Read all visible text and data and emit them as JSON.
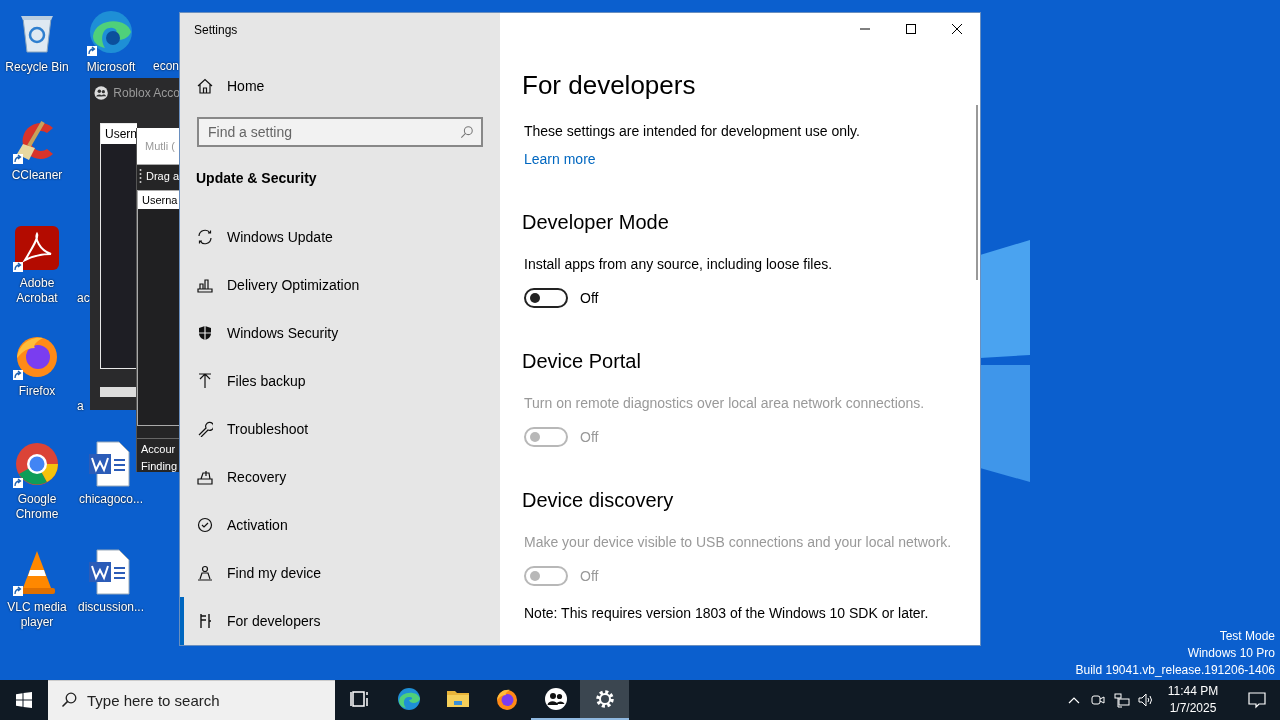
{
  "desktop": {
    "icon_columns": [
      [
        {
          "label": "Recycle Bin",
          "kind": "recycle"
        },
        {
          "label": "CCleaner",
          "kind": "ccleaner"
        },
        {
          "label": "Adobe Acrobat",
          "kind": "acrobat"
        },
        {
          "label": "Firefox",
          "kind": "firefox"
        },
        {
          "label": "Google Chrome",
          "kind": "chrome"
        },
        {
          "label": "VLC media player",
          "kind": "vlc"
        }
      ],
      [
        {
          "label": "Microsoft",
          "kind": "edge"
        },
        {
          "kind": "hidden"
        },
        {
          "label": "ac",
          "kind": "cut"
        },
        {
          "label": "a",
          "kind": "cut"
        },
        {
          "label": "chicagoco...",
          "kind": "word"
        },
        {
          "label": "discussion...",
          "kind": "word"
        }
      ],
      [
        {
          "label": "econ",
          "kind": "cut"
        }
      ]
    ],
    "system_text": [
      "Test Mode",
      "Windows 10 Pro",
      "Build 19041.vb_release.191206-1406"
    ]
  },
  "roblox_window": {
    "title": "Roblox Acco",
    "list_header": "Usern"
  },
  "multi_window": {
    "field": "Mutli (",
    "drag_label": "Drag a",
    "list_header": "Userna",
    "status_lines": [
      "Accour",
      "Finding"
    ]
  },
  "settings": {
    "title": "Settings",
    "home": "Home",
    "search": {
      "placeholder": "Find a setting"
    },
    "section": "Update & Security",
    "nav": [
      {
        "label": "Windows Update",
        "kind": "sync",
        "selected": false
      },
      {
        "label": "Delivery Optimization",
        "kind": "delivery",
        "selected": false
      },
      {
        "label": "Windows Security",
        "kind": "shield",
        "selected": false
      },
      {
        "label": "Files backup",
        "kind": "backup",
        "selected": false
      },
      {
        "label": "Troubleshoot",
        "kind": "wrench",
        "selected": false
      },
      {
        "label": "Recovery",
        "kind": "recovery",
        "selected": false
      },
      {
        "label": "Activation",
        "kind": "check",
        "selected": false
      },
      {
        "label": "Find my device",
        "kind": "find",
        "selected": false
      },
      {
        "label": "For developers",
        "kind": "developer",
        "selected": true
      }
    ],
    "page": {
      "title": "For developers",
      "intro": "These settings are intended for development use only.",
      "link": "Learn more",
      "sections": [
        {
          "heading": "Developer Mode",
          "description": "Install apps from any source, including loose files.",
          "toggle": {
            "on": false,
            "disabled": false,
            "label": "Off"
          }
        },
        {
          "heading": "Device Portal",
          "description": "Turn on remote diagnostics over local area network connections.",
          "toggle": {
            "on": false,
            "disabled": true,
            "label": "Off"
          }
        },
        {
          "heading": "Device discovery",
          "description": "Make your device visible to USB connections and your local network.",
          "toggle": {
            "on": false,
            "disabled": true,
            "label": "Off"
          }
        }
      ],
      "note": "Note: This requires version 1803 of the Windows 10 SDK or later."
    }
  },
  "taskbar": {
    "search": {
      "placeholder": "Type here to search"
    },
    "apps": [
      {
        "kind": "taskview",
        "running": false,
        "active": false
      },
      {
        "kind": "edge",
        "running": false,
        "active": false
      },
      {
        "kind": "explorer",
        "running": false,
        "active": false
      },
      {
        "kind": "firefox",
        "running": false,
        "active": false
      },
      {
        "kind": "roblox",
        "running": true,
        "active": false
      },
      {
        "kind": "settings",
        "running": true,
        "active": true
      }
    ],
    "time": "11:44 PM",
    "date": "1/7/2025"
  }
}
